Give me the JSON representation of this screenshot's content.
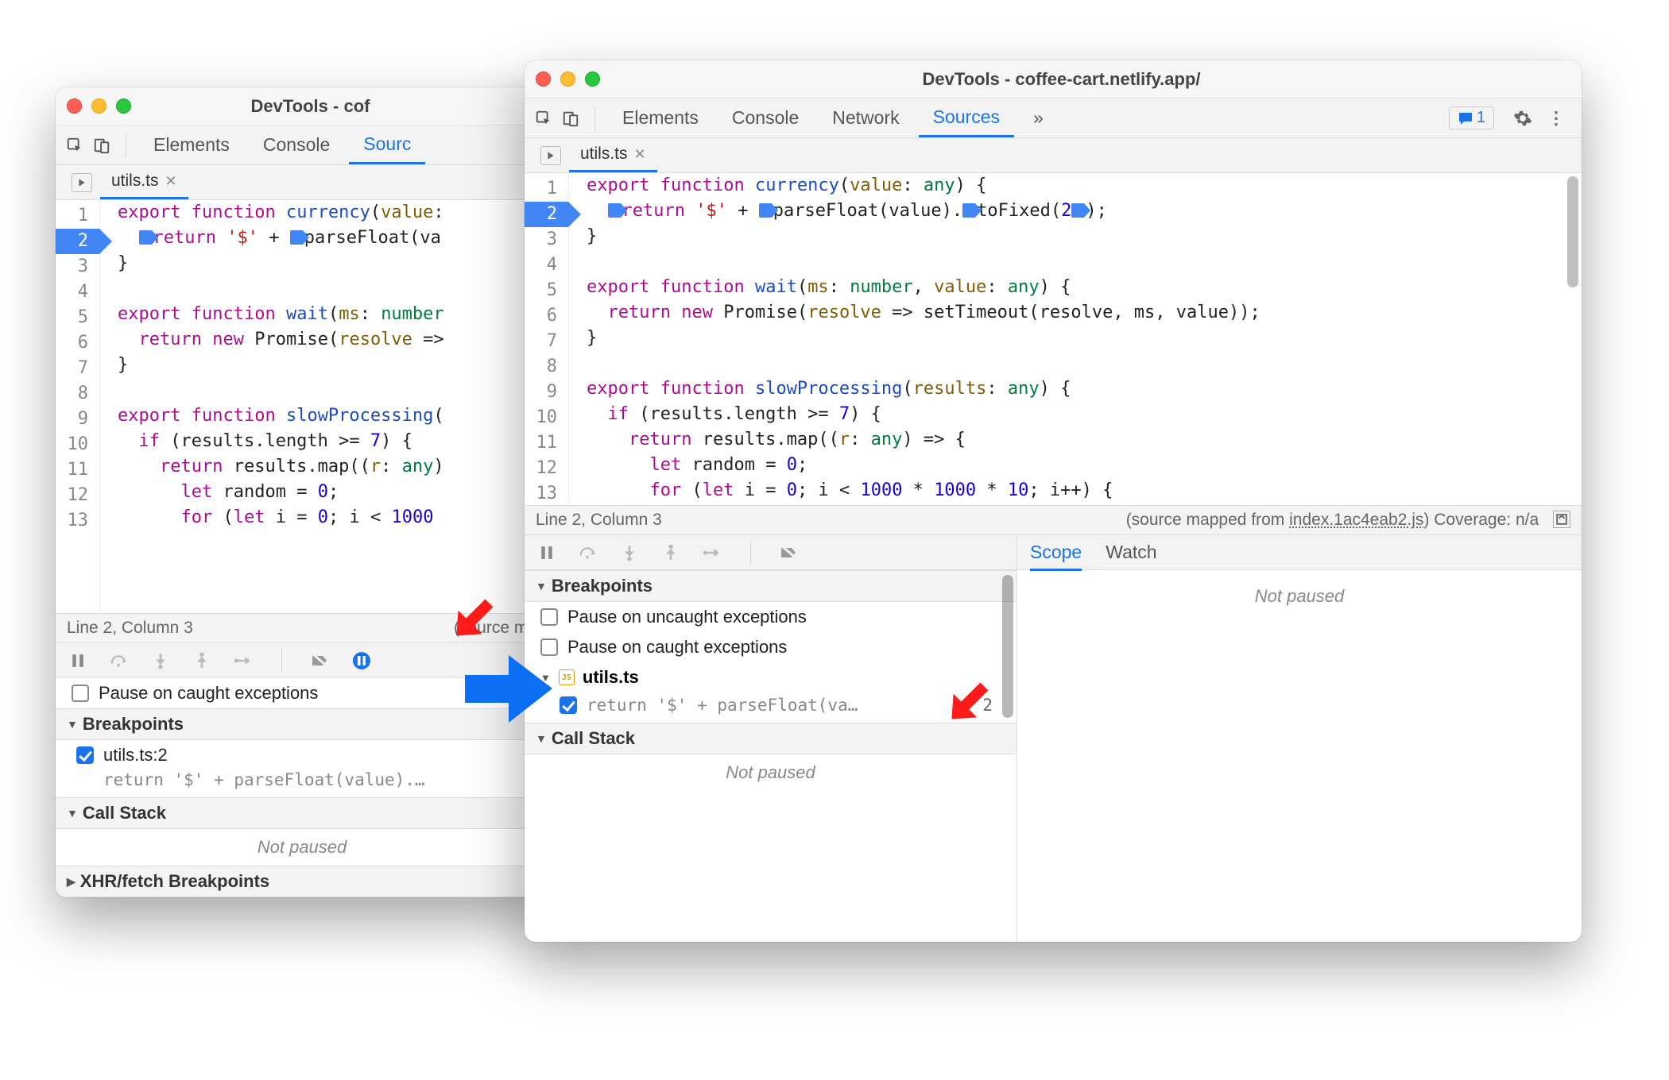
{
  "window_left": {
    "title": "DevTools - cof",
    "tabs": [
      "Elements",
      "Console",
      "Sourc"
    ],
    "active_tab": "Sourc",
    "file_tab": "utils.ts",
    "status_left": "Line 2, Column 3",
    "status_right": "(source ma",
    "pause_exceptions": "Pause on caught exceptions",
    "breakpoints_title": "Breakpoints",
    "bp_file": "utils.ts:2",
    "bp_code": "return '$' + parseFloat(value).…",
    "callstack_title": "Call Stack",
    "not_paused": "Not paused",
    "xhr_title": "XHR/fetch Breakpoints",
    "code_lines": {
      "l1": "export function currency(value:",
      "l2": "return '$' + parseFloat(va",
      "l3": "}",
      "l5": "export function wait(ms: number",
      "l6": "  return new Promise(resolve =>",
      "l7": "}",
      "l9": "export function slowProcessing(",
      "l10": "  if (results.length >= 7) {",
      "l11": "    return results.map((r: any)",
      "l12": "      let random = 0;"
    }
  },
  "window_right": {
    "title": "DevTools - coffee-cart.netlify.app/",
    "tabs": [
      "Elements",
      "Console",
      "Network",
      "Sources"
    ],
    "active_tab": "Sources",
    "issues_count": "1",
    "file_tab": "utils.ts",
    "status_left": "Line 2, Column 3",
    "status_right_prefix": "(source mapped from ",
    "status_right_file": "index.1ac4eab2.js",
    "status_right_suffix": ") Coverage: n/a",
    "breakpoints_title": "Breakpoints",
    "pause_uncaught": "Pause on uncaught exceptions",
    "pause_caught": "Pause on caught exceptions",
    "bp_file": "utils.ts",
    "bp_code": "return '$' + parseFloat(va…",
    "bp_line": "2",
    "callstack_title": "Call Stack",
    "not_paused": "Not paused",
    "scope_tab": "Scope",
    "watch_tab": "Watch",
    "scope_not_paused": "Not paused"
  }
}
